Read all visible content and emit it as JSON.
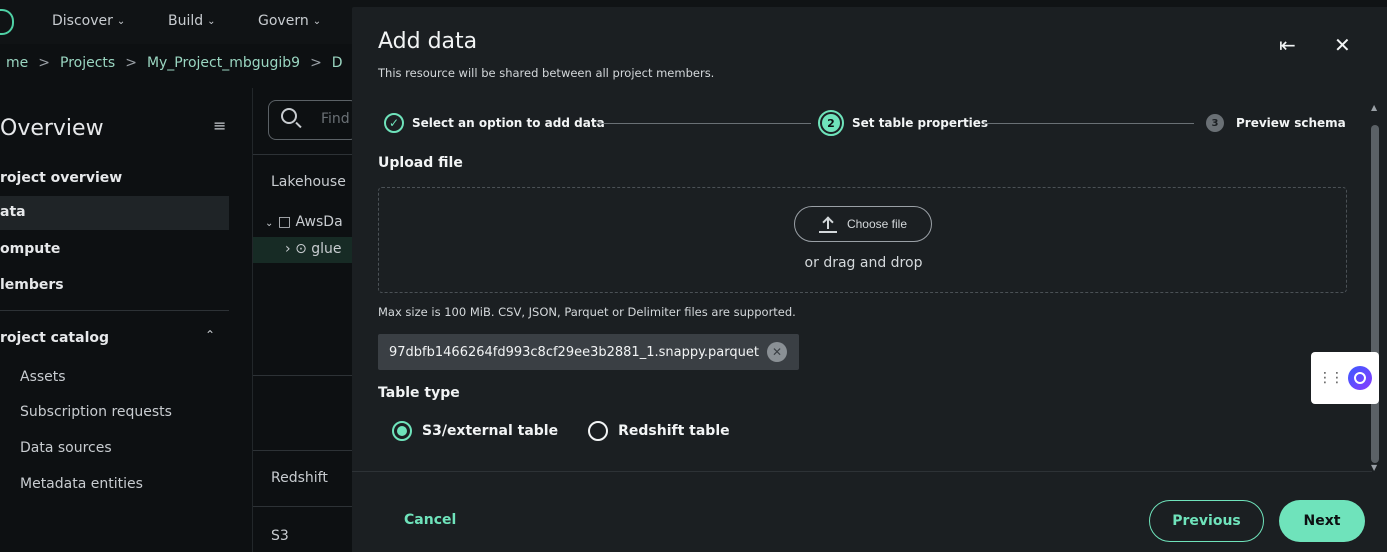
{
  "topnav": {
    "items": [
      "Discover",
      "Build",
      "Govern"
    ]
  },
  "breadcrumb": {
    "items": [
      "me",
      "Projects",
      "My_Project_mbgugib9",
      "D"
    ]
  },
  "sidebar": {
    "title": "Overview",
    "items": [
      "roject overview",
      "ata",
      "ompute",
      "lembers"
    ],
    "catalog_label": "roject catalog",
    "catalog_items": [
      "Assets",
      "Subscription requests",
      "Data sources",
      "Metadata entities"
    ]
  },
  "midpanel": {
    "search_placeholder": "Find",
    "lakehouse": "Lakehouse",
    "tree_db": "AwsDa",
    "tree_glue": "glue",
    "redshift": "Redshift",
    "s3": "S3"
  },
  "modal": {
    "title": "Add data",
    "subtitle": "This resource will be shared between all project members.",
    "steps": [
      {
        "number": "1",
        "label": "Select an option to add data",
        "state": "done"
      },
      {
        "number": "2",
        "label": "Set table properties",
        "state": "current"
      },
      {
        "number": "3",
        "label": "Preview schema",
        "state": "upcoming"
      }
    ],
    "upload_label": "Upload file",
    "choose_file": "Choose file",
    "drag_drop": "or drag and drop",
    "hint": "Max size is 100 MiB. CSV, JSON, Parquet or Delimiter files are supported.",
    "file_name": "97dbfb1466264fd993c8cf29ee3b2881_1.snappy.parquet",
    "table_type_label": "Table type",
    "table_types": [
      {
        "label": "S3/external table",
        "selected": true
      },
      {
        "label": "Redshift table",
        "selected": false
      }
    ],
    "cancel": "Cancel",
    "previous": "Previous",
    "next": "Next"
  },
  "colors": {
    "accent": "#6fe3bb",
    "modal_bg": "#1b1f22",
    "page_bg": "#0d1012"
  },
  "icons": {
    "collapse": "collapse-sidebar-icon",
    "back": "collapse-panel-icon",
    "close": "close-icon",
    "upload": "upload-icon",
    "remove": "remove-file-icon"
  }
}
